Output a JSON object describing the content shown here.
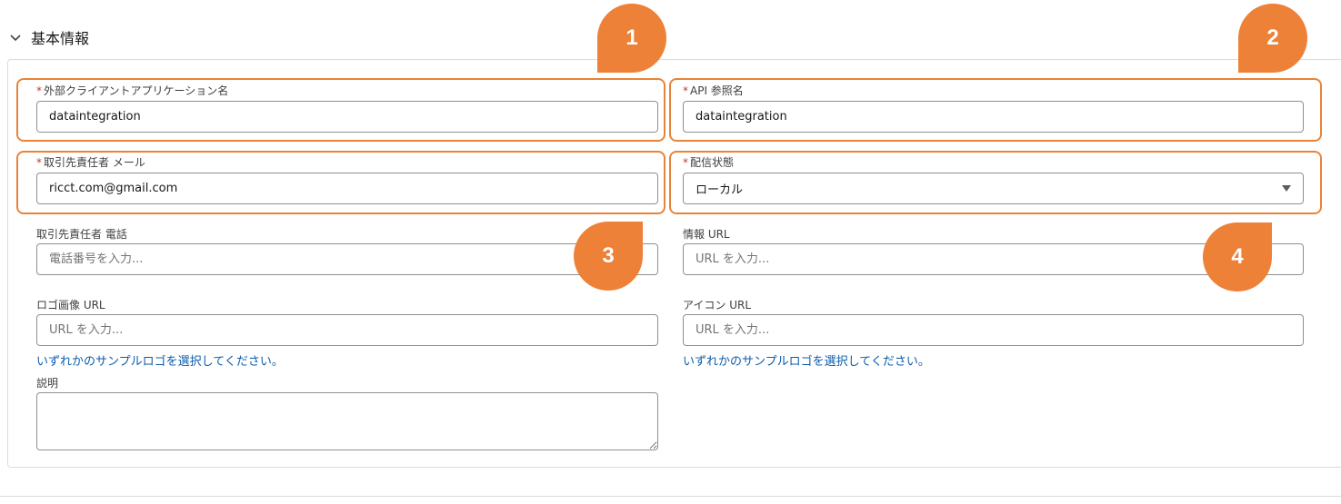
{
  "section": {
    "title": "基本情報"
  },
  "fields": {
    "app_name": {
      "label": "外部クライアントアプリケーション名",
      "value": "dataintegration",
      "required": "*"
    },
    "api_name": {
      "label": "API 参照名",
      "value": "dataintegration",
      "required": "*"
    },
    "contact_email": {
      "label": "取引先責任者 メール",
      "value": "ricct.com@gmail.com",
      "required": "*"
    },
    "distribution_state": {
      "label": "配信状態",
      "value": "ローカル",
      "required": "*"
    },
    "contact_phone": {
      "label": "取引先責任者 電話",
      "placeholder": "電話番号を入力..."
    },
    "info_url": {
      "label": "情報 URL",
      "placeholder": "URL を入力..."
    },
    "logo_url": {
      "label": "ロゴ画像 URL",
      "placeholder": "URL を入力...",
      "link": "いずれかのサンプルロゴを選択してください。"
    },
    "icon_url": {
      "label": "アイコン URL",
      "placeholder": "URL を入力...",
      "link": "いずれかのサンプルロゴを選択してください。"
    },
    "description": {
      "label": "説明"
    }
  },
  "callouts": [
    "1",
    "2",
    "3",
    "4"
  ],
  "colors": {
    "highlight": "#e8843a",
    "callout": "#ec8137",
    "link": "#0b5cab",
    "required": "#c23934"
  },
  "icons": {
    "section_toggle": "chevron-down-icon",
    "select_arrow": "caret-down-icon"
  }
}
